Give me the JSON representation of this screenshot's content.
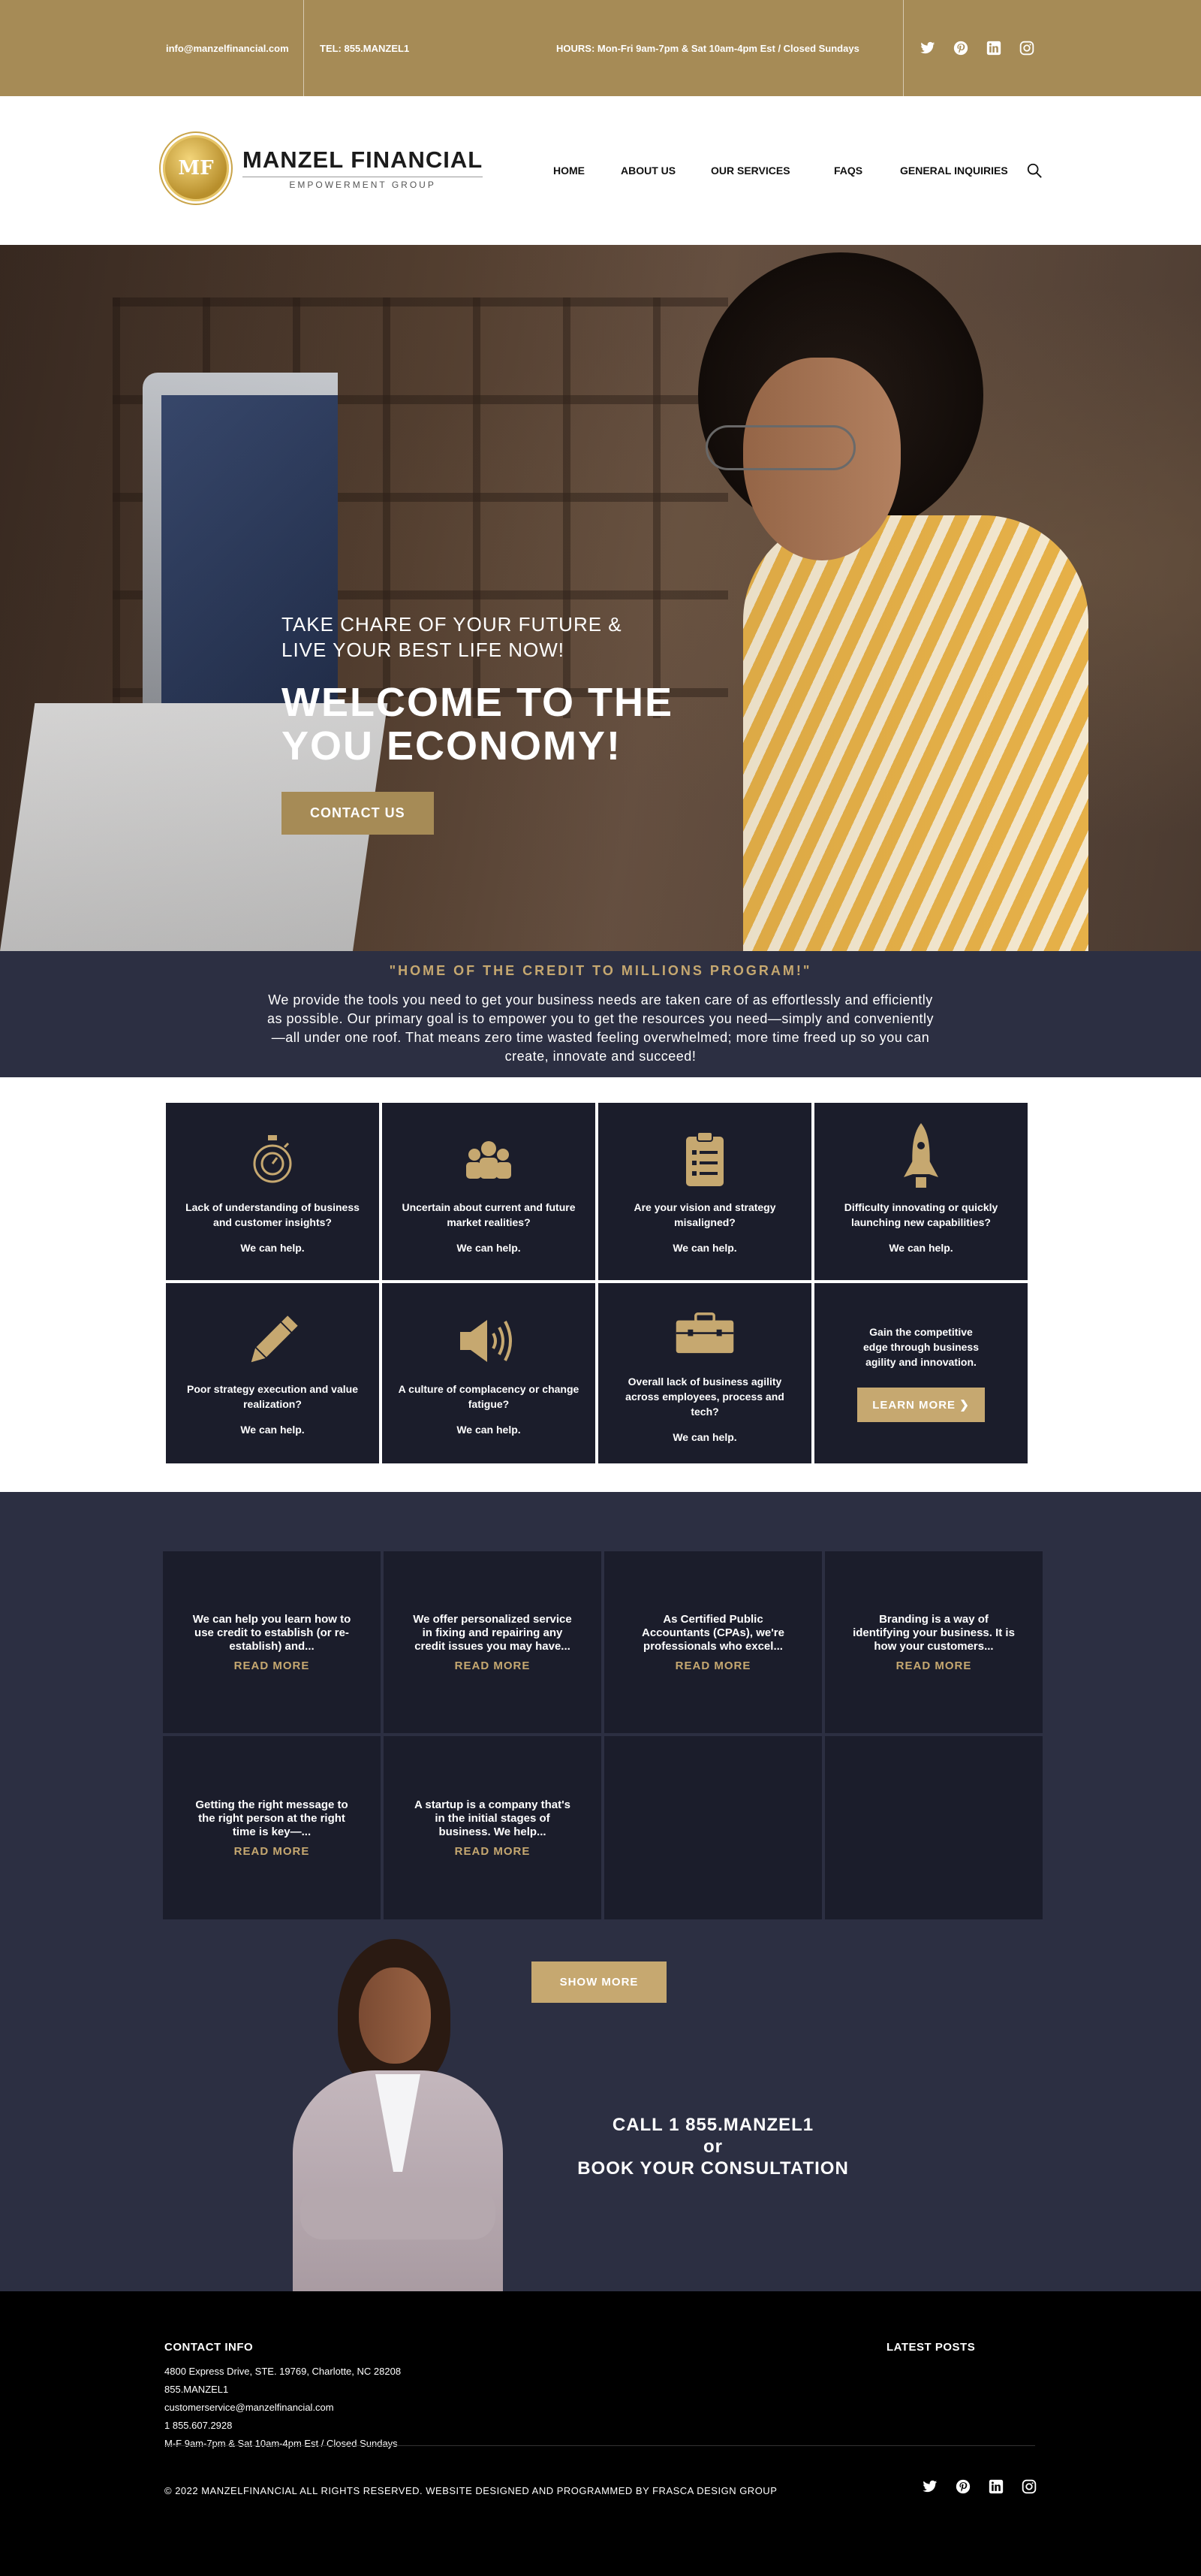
{
  "topbar": {
    "email": "info@manzelfinancial.com",
    "tel": "TEL: 855.MANZEL1",
    "hours": "HOURS: Mon-Fri 9am-7pm & Sat 10am-4pm Est / Closed Sundays",
    "social": [
      "twitter-icon",
      "pinterest-icon",
      "linkedin-icon",
      "instagram-icon"
    ]
  },
  "brand": {
    "name": "MANZEL FINANCIAL",
    "sub": "EMPOWERMENT GROUP",
    "mark": "MF"
  },
  "nav": {
    "home": "HOME",
    "about": "ABOUT US",
    "services": "OUR SERVICES",
    "faqs": "FAQS",
    "inquiries": "GENERAL INQUIRIES"
  },
  "hero": {
    "tagline_1": "TAKE CHARE OF YOUR FUTURE &",
    "tagline_2": "LIVE YOUR BEST LIFE NOW!",
    "title_1": "WELCOME TO THE",
    "title_2": "YOU ECONOMY!",
    "cta": "CONTACT US"
  },
  "intro": {
    "tag": "\"HOME OF THE CREDIT TO MILLIONS PROGRAM!\"",
    "body": "We provide the tools you need to get your business needs are taken care of as effortlessly and efficiently as possible. Our primary goal is to empower you to get the resources you need—simply and conveniently—all under one roof. That means zero time wasted feeling overwhelmed; more time freed up so you can create, innovate and succeed!"
  },
  "challenges": [
    {
      "icon": "stopwatch-icon",
      "text": "Lack of understanding of business and customer insights?",
      "help": "We can help."
    },
    {
      "icon": "people-icon",
      "text": "Uncertain about current and future market realities?",
      "help": "We can help."
    },
    {
      "icon": "clipboard-icon",
      "text": "Are your vision and strategy misaligned?",
      "help": "We can help."
    },
    {
      "icon": "rocket-icon",
      "text": "Difficulty innovating or quickly launching new capabilities?",
      "help": "We can help."
    },
    {
      "icon": "pencil-icon",
      "text": "Poor strategy execution and value realization?",
      "help": "We can help."
    },
    {
      "icon": "megaphone-icon",
      "text": "A culture of complacency or change fatigue?",
      "help": "We can help."
    },
    {
      "icon": "briefcase-icon",
      "text": "Overall lack of business agility across employees, process and tech?",
      "help": "We can help."
    }
  ],
  "edge": {
    "text": "Gain the competitive edge through business agility and innovation.",
    "button": "LEARN MORE ❯"
  },
  "services": [
    {
      "text": "We can help you learn how to use credit to establish (or re-establish) and...",
      "more": "READ MORE"
    },
    {
      "text": "We offer personalized service in fixing and repairing any credit issues you may have...",
      "more": "READ MORE"
    },
    {
      "text": "As Certified Public Accountants (CPAs), we're professionals who excel...",
      "more": "READ MORE"
    },
    {
      "text": "Branding is a way of identifying your business. It is how your customers...",
      "more": "READ MORE"
    },
    {
      "text": "Getting the right message to the right person at the right time is key—...",
      "more": "READ MORE"
    },
    {
      "text": "A startup is a company that's in the initial stages of business. We help...",
      "more": "READ MORE"
    }
  ],
  "show_more": "SHOW MORE",
  "call": {
    "line1": "CALL 1 855.MANZEL1",
    "line2": "or",
    "line3": "BOOK YOUR CONSULTATION"
  },
  "footer": {
    "contact_title": "CONTACT INFO",
    "address": "4800 Express Drive, STE. 19769, Charlotte, NC 28208",
    "phone_word": "855.MANZEL1",
    "email": "customerservice@manzelfinancial.com",
    "phone": "1 855.607.2928",
    "hours": "M-F 9am-7pm & Sat 10am-4pm Est / Closed Sundays",
    "latest_title": "LATEST POSTS",
    "copyright": "© 2022 MANZELFINANCIAL ALL RIGHTS RESERVED. WEBSITE DESIGNED AND PROGRAMMED BY FRASCA DESIGN GROUP"
  },
  "colors": {
    "gold": "#a68b56",
    "gold_light": "#c6a870",
    "navy": "#2c2f42",
    "card": "#1b1d2b"
  }
}
